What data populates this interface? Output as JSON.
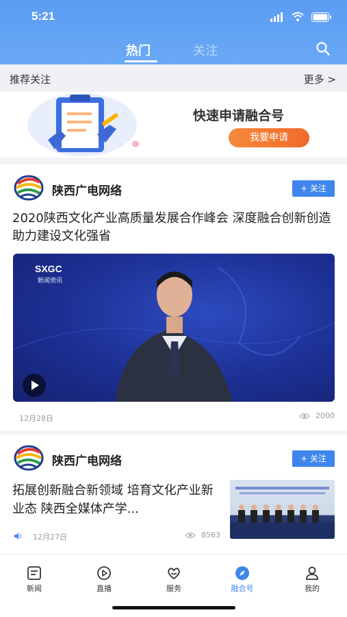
{
  "status_bar": {
    "time": "5:21"
  },
  "header": {
    "tabs": [
      {
        "label": "热门",
        "active": true
      },
      {
        "label": "关注",
        "active": false
      }
    ],
    "search_icon": "search-icon"
  },
  "recommend": {
    "title": "推荐关注",
    "more": "更多 >"
  },
  "banner": {
    "title": "快速申请融合号",
    "button": "我要申请",
    "button_color": "#f0742f"
  },
  "feed": [
    {
      "source": "陕西广电网络",
      "follow_label": "+ 关注",
      "title": "2020陕西文化产业高质量发展合作峰会 深度融合创新创造助力建设文化强省",
      "video_logo_top": "SXGC",
      "video_logo_bottom": "新闻资讯",
      "date": "12月28日",
      "views": "2000"
    },
    {
      "source": "陕西广电网络",
      "follow_label": "+ 关注",
      "title": "拓展创新融合新领域 培育文化产业新业态 陕西全媒体产学...",
      "date": "12月27日",
      "views": "8563"
    }
  ],
  "tabbar": [
    {
      "label": "新闻",
      "icon": "news-icon",
      "active": false
    },
    {
      "label": "直播",
      "icon": "live-play-icon",
      "active": false
    },
    {
      "label": "服务",
      "icon": "service-heart-icon",
      "active": false
    },
    {
      "label": "融合号",
      "icon": "compass-icon",
      "active": true
    },
    {
      "label": "我的",
      "icon": "profile-icon",
      "active": false
    }
  ],
  "colors": {
    "header": "#5a9cf2",
    "accent": "#3f86ec",
    "banner_button": "#f0742f"
  }
}
